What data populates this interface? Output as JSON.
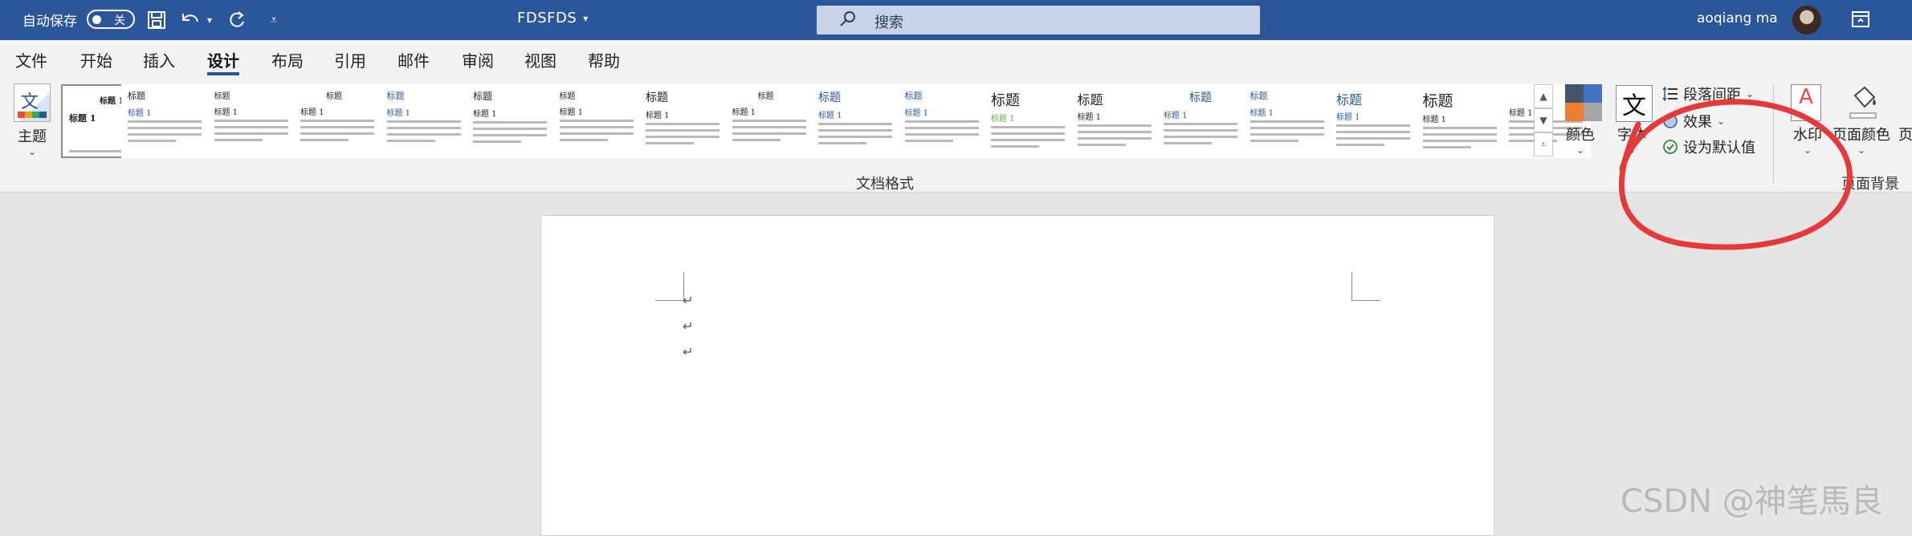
{
  "titlebar": {
    "autosave_label": "自动保存",
    "toggle_state": "关",
    "doc_title": "FDSFDS",
    "search_placeholder": "搜索",
    "user_name": "aoqiang ma"
  },
  "menu": {
    "tabs": [
      "文件",
      "开始",
      "插入",
      "设计",
      "布局",
      "引用",
      "邮件",
      "审阅",
      "视图",
      "帮助"
    ],
    "active_tab": "设计"
  },
  "ribbon": {
    "theme_label": "主题",
    "gallery_group_label": "文档格式",
    "style_titles": [
      "标题 1",
      "标题",
      "标题",
      "标题",
      "标题",
      "标题",
      "标题",
      "标题",
      "标题",
      "标题",
      "标题",
      "标题",
      "标题",
      "标题",
      "标题",
      "标题",
      "标题",
      "标题",
      "标题"
    ],
    "colors_label": "颜色",
    "fonts_label": "字体",
    "para_spacing_label": "段落间距",
    "effects_label": "效果",
    "set_default_label": "设为默认值",
    "watermark_label": "水印",
    "page_color_label": "页面颜色",
    "page_bg_group_label": "页面背景"
  },
  "colors": {
    "brand": "#2b579a",
    "annotation": "#e63a3a"
  },
  "doc": {
    "para_marks": [
      "↵",
      "↵",
      "↵"
    ]
  },
  "watermark_text": "CSDN @神笔馬良"
}
